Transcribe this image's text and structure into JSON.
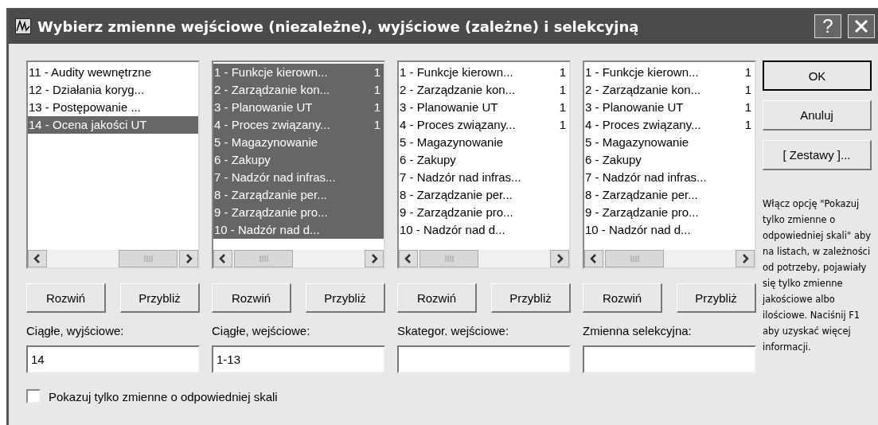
{
  "window": {
    "title": "Wybierz zmienne wejściowe (niezależne), wyjściowe (zależne) i selekcyjną",
    "help": "?"
  },
  "lists": [
    {
      "items": [
        {
          "label": "11 - Audity wewnętrzne",
          "selected": false
        },
        {
          "label": "12 - Działania koryg...",
          "selected": false
        },
        {
          "label": "13 - Postępowanie ...",
          "selected": false
        },
        {
          "label": "14 - Ocena jakości UT",
          "selected": true
        }
      ],
      "buttons": [
        "Rozwiń",
        "Przybliż"
      ],
      "field_label": "Ciągłe, wyjściowe:",
      "field_value": "14"
    },
    {
      "items": [
        {
          "label": "1 - Funkcje kierown...",
          "count": "1",
          "selected": true
        },
        {
          "label": "2 - Zarządzanie kon...",
          "count": "1",
          "selected": true
        },
        {
          "label": "3 - Planowanie UT",
          "count": "1",
          "selected": true
        },
        {
          "label": "4 - Proces związany...",
          "count": "1",
          "selected": true
        },
        {
          "label": "5 - Magazynowanie",
          "selected": true
        },
        {
          "label": "6 - Zakupy",
          "selected": true
        },
        {
          "label": "7 - Nadzór nad infras...",
          "selected": true
        },
        {
          "label": "8 - Zarządzanie per...",
          "selected": true
        },
        {
          "label": "9 - Zarządzanie pro...",
          "selected": true
        },
        {
          "label": "10 - Nadzór nad d...",
          "selected": true
        }
      ],
      "buttons": [
        "Rozwiń",
        "Przybliż"
      ],
      "field_label": "Ciągłe, wejściowe:",
      "field_value": "1-13"
    },
    {
      "items": [
        {
          "label": "1 - Funkcje kierown...",
          "count": "1",
          "selected": false
        },
        {
          "label": "2 - Zarządzanie kon...",
          "count": "1",
          "selected": false
        },
        {
          "label": "3 - Planowanie UT",
          "count": "1",
          "selected": false
        },
        {
          "label": "4 - Proces związany...",
          "count": "1",
          "selected": false
        },
        {
          "label": "5 - Magazynowanie",
          "selected": false
        },
        {
          "label": "6 - Zakupy",
          "selected": false
        },
        {
          "label": "7 - Nadzór nad infras...",
          "selected": false
        },
        {
          "label": "8 - Zarządzanie per...",
          "selected": false
        },
        {
          "label": "9 - Zarządzanie pro...",
          "selected": false
        },
        {
          "label": "10 - Nadzór nad d...",
          "selected": false
        }
      ],
      "buttons": [
        "Rozwiń",
        "Przybliż"
      ],
      "field_label": "Skategor. wejściowe:"
    },
    {
      "items": [
        {
          "label": "1 - Funkcje kierown...",
          "count": "1",
          "selected": false
        },
        {
          "label": "2 - Zarządzanie kon...",
          "count": "1",
          "selected": false
        },
        {
          "label": "3 - Planowanie UT",
          "count": "1",
          "selected": false
        },
        {
          "label": "4 - Proces związany...",
          "count": "1",
          "selected": false
        },
        {
          "label": "5 - Magazynowanie",
          "selected": false
        },
        {
          "label": "6 - Zakupy",
          "selected": false
        },
        {
          "label": "7 - Nadzór nad infras...",
          "selected": false
        },
        {
          "label": "8 - Zarządzanie per...",
          "selected": false
        },
        {
          "label": "9 - Zarządzanie pro...",
          "selected": false
        },
        {
          "label": "10 - Nadzór nad d...",
          "selected": false
        }
      ],
      "buttons": [
        "Rozwiń",
        "Przybliż"
      ],
      "field_label": "Zmienna selekcyjna:"
    }
  ],
  "actions": [
    "OK",
    "Anuluj",
    "[ Zestawy ]..."
  ],
  "hint": "Włącz opcję \"Pokazuj tylko zmienne o odpowiedniej skali\" aby na listach, w zależności od potrzeby, pojawiały się tylko zmienne jakościowe albo ilościowe. Naciśnij F1 aby uzyskać więcej informacji.",
  "checkbox": {
    "label": "Pokazuj tylko zmienne o odpowiedniej skali",
    "checked": false
  }
}
